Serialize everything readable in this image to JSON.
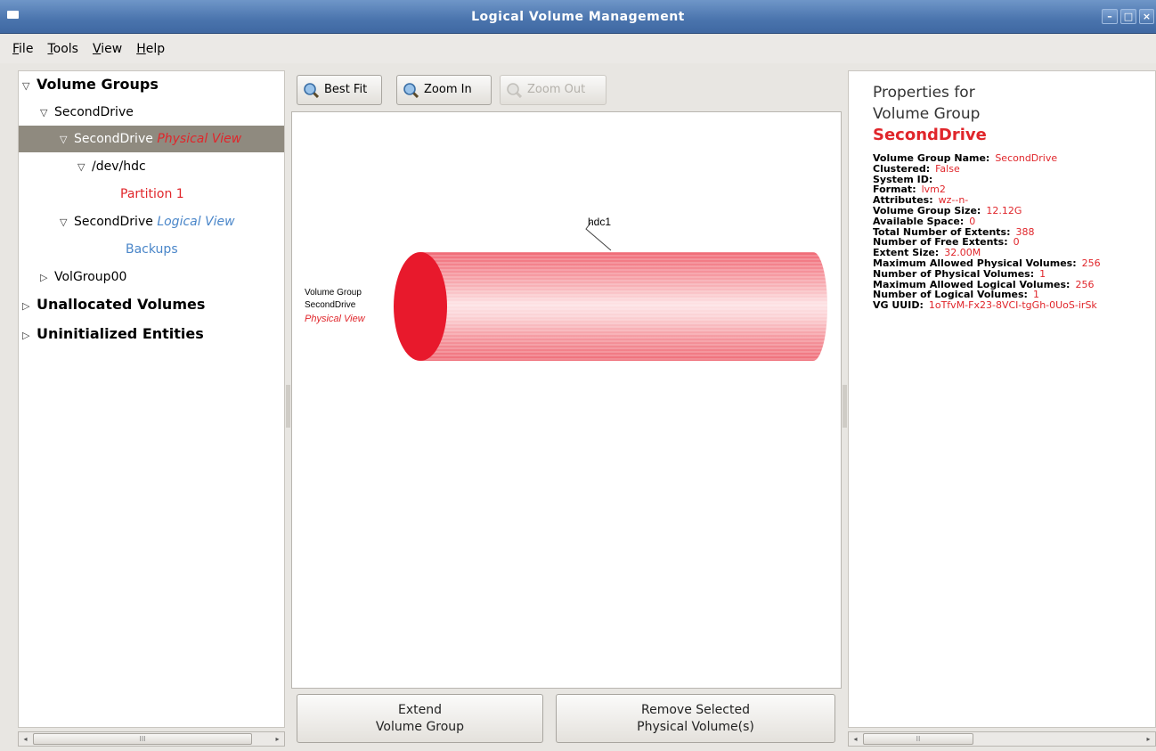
{
  "window": {
    "title": "Logical Volume Management"
  },
  "menu": [
    {
      "key": "F",
      "rest": "ile",
      "name": "menu-file"
    },
    {
      "key": "T",
      "rest": "ools",
      "name": "menu-tools"
    },
    {
      "key": "V",
      "rest": "iew",
      "name": "menu-view"
    },
    {
      "key": "H",
      "rest": "elp",
      "name": "menu-help"
    }
  ],
  "tree": {
    "volume_groups": "Volume Groups",
    "vg_second": "SecondDrive",
    "pv_view_label": "SecondDrive",
    "pv_view_suffix": "Physical View",
    "dev_hdc": "/dev/hdc",
    "partition": "Partition 1",
    "lv_view_label": "SecondDrive",
    "lv_view_suffix": "Logical View",
    "backups": "Backups",
    "volgroup00": "VolGroup00",
    "unallocated": "Unallocated Volumes",
    "uninitialized": "Uninitialized Entities"
  },
  "toolbar": {
    "best_fit": "Best Fit",
    "zoom_in": "Zoom In",
    "zoom_out": "Zoom Out"
  },
  "canvas": {
    "label_line1": "Volume Group",
    "label_line2": "SecondDrive",
    "label_line3": "Physical View",
    "pv_label": "hdc1",
    "colors": {
      "cap": "#e8192c",
      "body": "#f4a0a6"
    }
  },
  "buttons": {
    "extend_line1": "Extend",
    "extend_line2": "Volume Group",
    "remove_line1": "Remove Selected",
    "remove_line2": "Physical Volume(s)"
  },
  "properties": {
    "heading1": "Properties for",
    "heading2": "Volume Group",
    "heading3": "SecondDrive",
    "rows": [
      {
        "k": "Volume Group Name:",
        "v": "SecondDrive"
      },
      {
        "k": "Clustered:",
        "v": "False"
      },
      {
        "k": "System ID:",
        "v": ""
      },
      {
        "k": "Format:",
        "v": "lvm2"
      },
      {
        "k": "Attributes:",
        "v": "wz--n-"
      },
      {
        "k": "Volume Group Size:",
        "v": "12.12G"
      },
      {
        "k": "Available Space:",
        "v": "0"
      },
      {
        "k": "Total Number of Extents:",
        "v": "388"
      },
      {
        "k": "Number of Free Extents:",
        "v": "0"
      },
      {
        "k": "Extent Size:",
        "v": "32.00M"
      },
      {
        "k": "Maximum Allowed Physical Volumes:",
        "v": "256"
      },
      {
        "k": "Number of Physical Volumes:",
        "v": "1"
      },
      {
        "k": "Maximum Allowed Logical Volumes:",
        "v": "256"
      },
      {
        "k": "Number of Logical Volumes:",
        "v": "1"
      },
      {
        "k": "VG UUID:",
        "v": "1oTfvM-Fx23-8VCI-tgGh-0UoS-irSk"
      }
    ]
  }
}
